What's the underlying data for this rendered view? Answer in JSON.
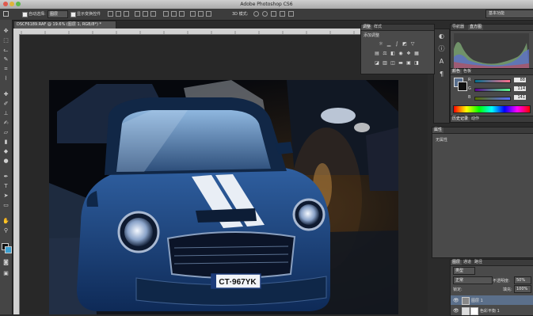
{
  "window": {
    "title": "Adobe Photoshop CS6"
  },
  "options_bar": {
    "auto_select_label": "自动选择:",
    "auto_select_value": "图层",
    "show_transform_label": "显示变换控件",
    "mode_3d_label": "3D 模式:",
    "workspace": "基本功能"
  },
  "document": {
    "tab_title": "DSCF6189.RAF @ 19.6% (图层 1, RGB/8*) *"
  },
  "photo": {
    "license_plate": "CT·967YK"
  },
  "adjustments": {
    "tabs": [
      "调整",
      "样式"
    ],
    "add_label": "添加调整"
  },
  "histogram": {
    "tabs": [
      "导航器",
      "直方图"
    ]
  },
  "color": {
    "tabs": [
      "颜色",
      "色板"
    ],
    "r_label": "R",
    "g_label": "G",
    "b_label": "B",
    "r_value": "88",
    "g_value": "114",
    "b_value": "141",
    "fg_color": "#586e8d"
  },
  "history": {
    "tabs": [
      "历史记录",
      "动作"
    ]
  },
  "properties": {
    "tab": "属性",
    "empty_text": "无属性"
  },
  "layers": {
    "tabs": [
      "图层",
      "通道",
      "路径"
    ],
    "filter": "类型",
    "blend_mode": "正常",
    "opacity_label": "不透明度:",
    "opacity_value": "50%",
    "lock_label": "锁定:",
    "fill_label": "填充:",
    "fill_value": "100%",
    "layer1": "图层 1",
    "layer2": "色彩平衡 1"
  }
}
